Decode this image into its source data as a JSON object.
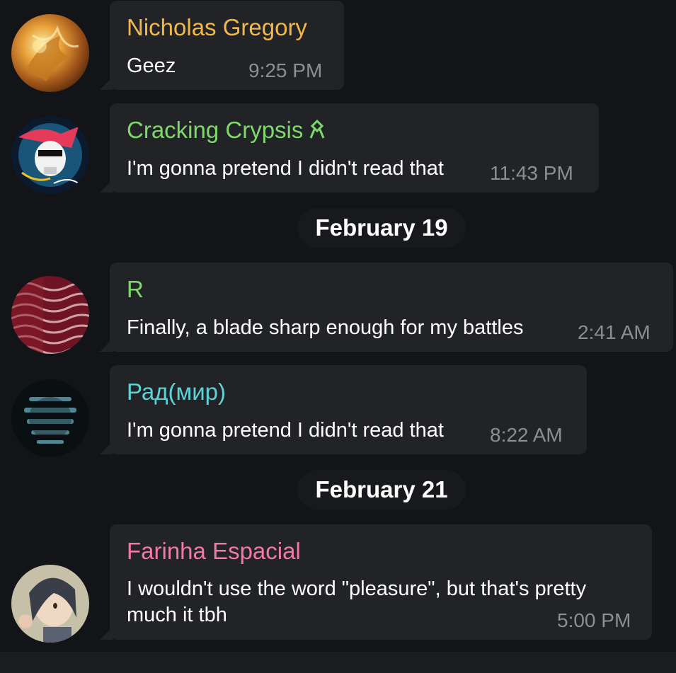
{
  "messages": [
    {
      "sender": "Nicholas Gregory",
      "sender_color": "#f2b84b",
      "text": "Geez",
      "time": "9:25 PM",
      "avatar_icon": "golden-dragon-avatar"
    },
    {
      "sender": "Cracking Crypsis",
      "sender_color": "#7ed96a",
      "text": "I'm gonna pretend I didn't read that",
      "time": "11:43 PM",
      "avatar_icon": "skull-graffiti-avatar",
      "badge_icon": "ribbon-badge-icon"
    },
    {
      "sender": "R",
      "sender_color": "#7ed96a",
      "text": "Finally, a blade sharp enough for my battles",
      "time": "2:41 AM",
      "avatar_icon": "red-pattern-avatar"
    },
    {
      "sender": "Рад(мир)",
      "sender_color": "#5dd3d6",
      "text": "I'm gonna pretend I didn't read that",
      "time": "8:22 AM",
      "avatar_icon": "dark-teal-mask-avatar"
    },
    {
      "sender": "Farinha Espacial",
      "sender_color": "#f07aa3",
      "text_line1": "I wouldn't use the word \"pleasure\", but that's pretty",
      "text_line2": "much it tbh",
      "time": "5:00 PM",
      "avatar_icon": "anime-character-avatar"
    }
  ],
  "dates": {
    "first": "February 19",
    "second": "February 21"
  },
  "colors": {
    "background": "#121417",
    "bubble": "#222326",
    "timestamp": "#8b8e93",
    "date_pill": "#17191c"
  }
}
